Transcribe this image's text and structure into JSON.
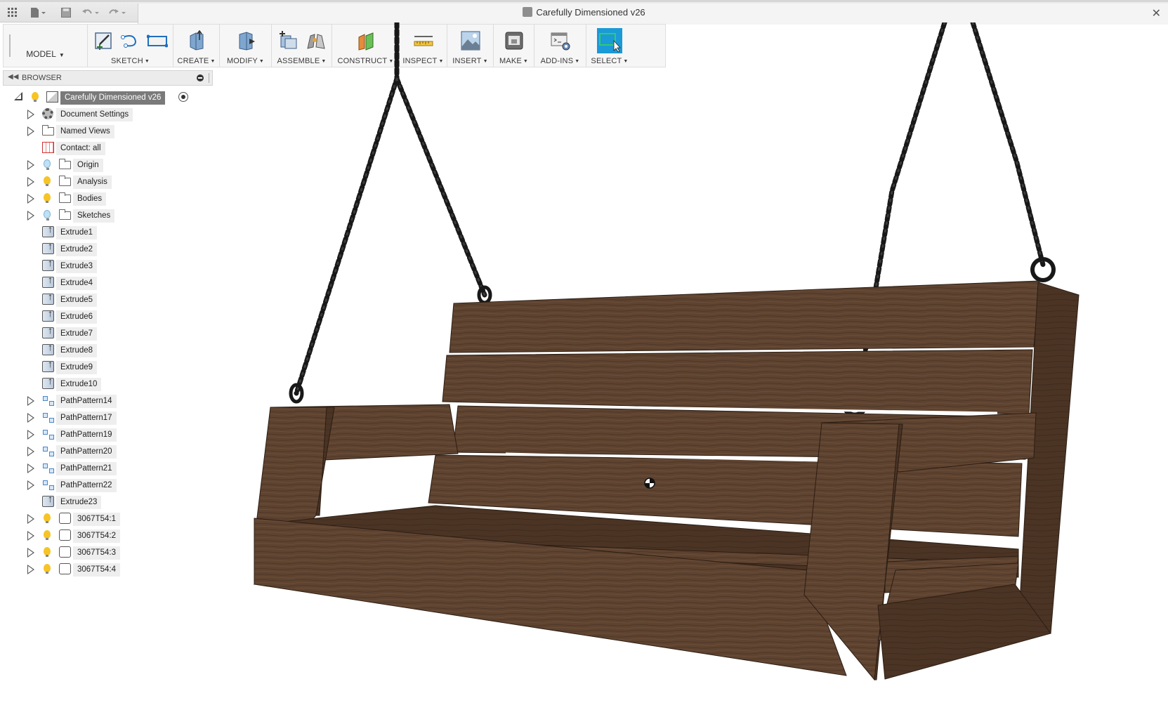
{
  "window": {
    "title": "Carefully Dimensioned v26"
  },
  "toolbar": {
    "workspace": "MODEL",
    "groups": [
      {
        "label": "SKETCH"
      },
      {
        "label": "CREATE"
      },
      {
        "label": "MODIFY"
      },
      {
        "label": "ASSEMBLE"
      },
      {
        "label": "CONSTRUCT"
      },
      {
        "label": "INSPECT"
      },
      {
        "label": "INSERT"
      },
      {
        "label": "MAKE"
      },
      {
        "label": "ADD-INS"
      },
      {
        "label": "SELECT"
      }
    ]
  },
  "browser": {
    "label": "BROWSER",
    "root": "Carefully Dimensioned v26",
    "items": [
      {
        "label": "Document Settings"
      },
      {
        "label": "Named Views"
      },
      {
        "label": "Contact: all"
      },
      {
        "label": "Origin"
      },
      {
        "label": "Analysis"
      },
      {
        "label": "Bodies"
      },
      {
        "label": "Sketches"
      },
      {
        "label": "Extrude1"
      },
      {
        "label": "Extrude2"
      },
      {
        "label": "Extrude3"
      },
      {
        "label": "Extrude4"
      },
      {
        "label": "Extrude5"
      },
      {
        "label": "Extrude6"
      },
      {
        "label": "Extrude7"
      },
      {
        "label": "Extrude8"
      },
      {
        "label": "Extrude9"
      },
      {
        "label": "Extrude10"
      },
      {
        "label": "PathPattern14"
      },
      {
        "label": "PathPattern17"
      },
      {
        "label": "PathPattern19"
      },
      {
        "label": "PathPattern20"
      },
      {
        "label": "PathPattern21"
      },
      {
        "label": "PathPattern22"
      },
      {
        "label": "Extrude23"
      },
      {
        "label": "3067T54:1"
      },
      {
        "label": "3067T54:2"
      },
      {
        "label": "3067T54:3"
      },
      {
        "label": "3067T54:4"
      }
    ]
  },
  "colors": {
    "wood": "#5e4330",
    "wood_dark": "#3f2b1d",
    "chain": "#1a1a1a",
    "select_accent": "#1a9ad6"
  }
}
